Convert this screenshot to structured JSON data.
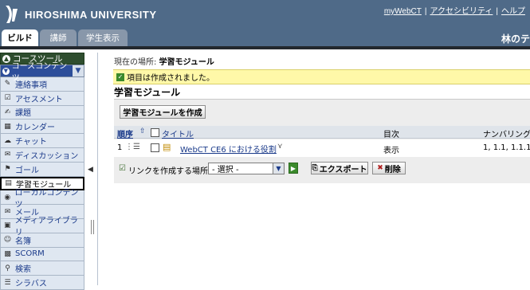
{
  "header": {
    "logo_text": "HIROSHIMA UNIVERSITY",
    "links": [
      "myWebCT",
      "アクセシビリティ",
      "ヘルプ"
    ],
    "tabs": [
      "ビルド",
      "講師",
      "学生表示"
    ],
    "course_title": "林のテ"
  },
  "sidebar": {
    "heading": "コースツール",
    "subheading": "コースコンテンツ",
    "items": [
      {
        "label": "連絡事項",
        "icon": "announcement-icon"
      },
      {
        "label": "アセスメント",
        "icon": "assessment-icon"
      },
      {
        "label": "課題",
        "icon": "assignment-icon"
      },
      {
        "label": "カレンダー",
        "icon": "calendar-icon"
      },
      {
        "label": "チャット",
        "icon": "chat-icon"
      },
      {
        "label": "ディスカッション",
        "icon": "discussion-icon"
      },
      {
        "label": "ゴール",
        "icon": "goal-icon"
      },
      {
        "label": "学習モジュール",
        "icon": "learning-module-icon"
      },
      {
        "label": "ローカルコンテンツ",
        "icon": "local-content-icon"
      },
      {
        "label": "メール",
        "icon": "mail-icon"
      },
      {
        "label": "メディアライブラリ",
        "icon": "media-library-icon"
      },
      {
        "label": "名簿",
        "icon": "roster-icon"
      },
      {
        "label": "SCORM",
        "icon": "scorm-icon"
      },
      {
        "label": "検索",
        "icon": "search-icon"
      },
      {
        "label": "シラバス",
        "icon": "syllabus-icon"
      }
    ]
  },
  "main": {
    "breadcrumb_prefix": "現在の場所:",
    "breadcrumb_current": "学習モジュール",
    "notice": "項目は作成されました。",
    "title": "学習モジュール",
    "create_button": "学習モジュールを作成",
    "columns": {
      "order": "順序",
      "title": "タイトル",
      "toc": "目次",
      "numbering": "ナンバリング"
    },
    "rows": [
      {
        "order": "1",
        "title": "WebCT CE6 における役割",
        "toc": "表示",
        "numbering": "1, 1.1, 1.1.1"
      }
    ],
    "link_label": "リンクを作成する場所:",
    "select_value": "- 選択 -",
    "export_button": "エクスポート",
    "delete_button": "削除"
  }
}
